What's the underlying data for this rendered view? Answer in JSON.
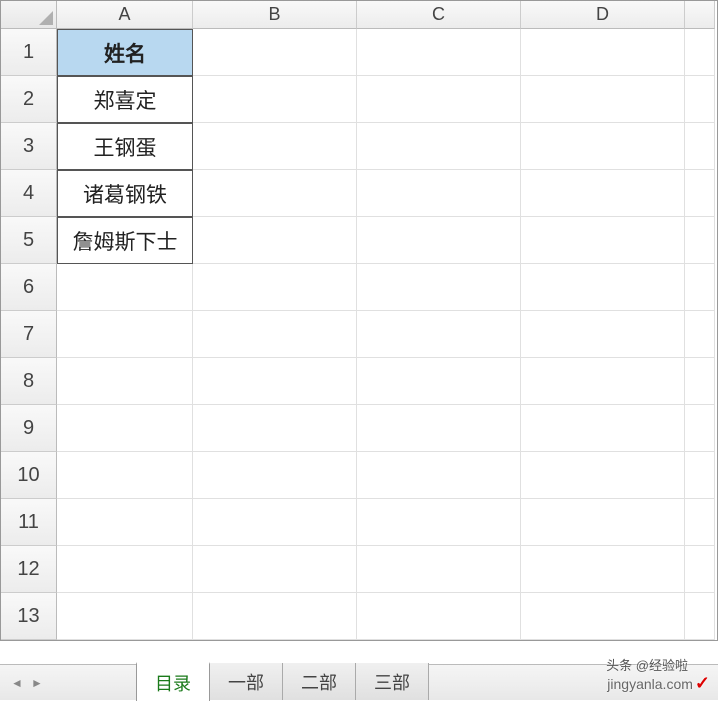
{
  "columns": [
    "A",
    "B",
    "C",
    "D"
  ],
  "rows": [
    "1",
    "2",
    "3",
    "4",
    "5",
    "6",
    "7",
    "8",
    "9",
    "10",
    "11",
    "12",
    "13"
  ],
  "cells": {
    "A1": "姓名",
    "A2": "郑喜定",
    "A3": "王钢蛋",
    "A4": "诸葛钢铁",
    "A5": "詹姆斯下士"
  },
  "tabs": [
    {
      "label": "目录",
      "active": true
    },
    {
      "label": "一部",
      "active": false
    },
    {
      "label": "二部",
      "active": false
    },
    {
      "label": "三部",
      "active": false
    }
  ],
  "watermark": {
    "top_line": "头条 @",
    "bottom_line": "jingyanla.com",
    "brand": "经验啦"
  }
}
